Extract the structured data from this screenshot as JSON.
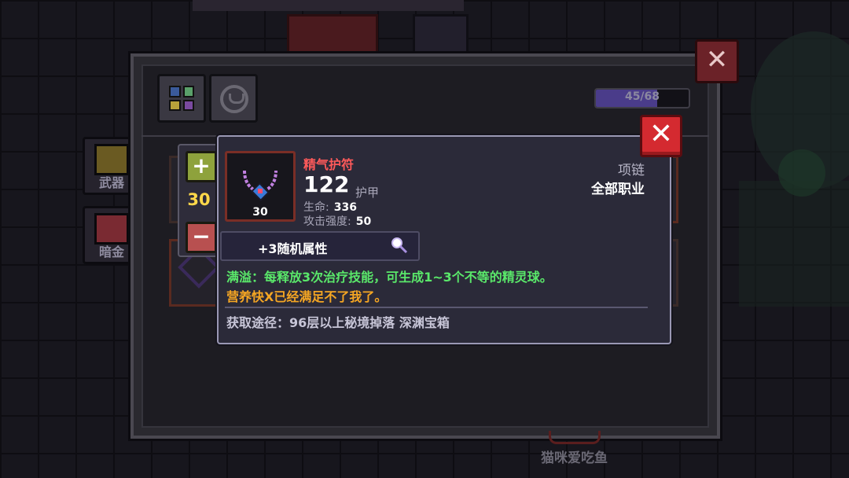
{
  "side_tabs": [
    {
      "label": "武器"
    },
    {
      "label": "暗金"
    }
  ],
  "inventory": {
    "capacity_text": "45/68",
    "capacity_fraction": 0.66
  },
  "quantity": {
    "value": "30",
    "plus": "+",
    "minus": "−"
  },
  "close_glyph": "✕",
  "item": {
    "name": "精气护符",
    "level": "30",
    "armor_value": "122",
    "armor_label": "护甲",
    "stats": [
      {
        "label": "生命:",
        "value": "336"
      },
      {
        "label": "攻击强度:",
        "value": "50"
      }
    ],
    "type": "项链",
    "class": "全部职业",
    "random_attr": "+3随机属性",
    "effect": "满溢：每释放3次治疗技能，可生成1~3个不等的精灵球。",
    "flavor": "营养快X已经满足不了我了。",
    "source": "获取途径：96层以上秘境掉落 深渊宝箱"
  },
  "background": {
    "bottom_label": "猫咪爱吃鱼"
  },
  "colors": {
    "item_name": "#ff5a5a",
    "effect": "#5ae86a",
    "flavor": "#f5a623",
    "quantity": "#ffd84a",
    "close_button": "#d42a30"
  }
}
